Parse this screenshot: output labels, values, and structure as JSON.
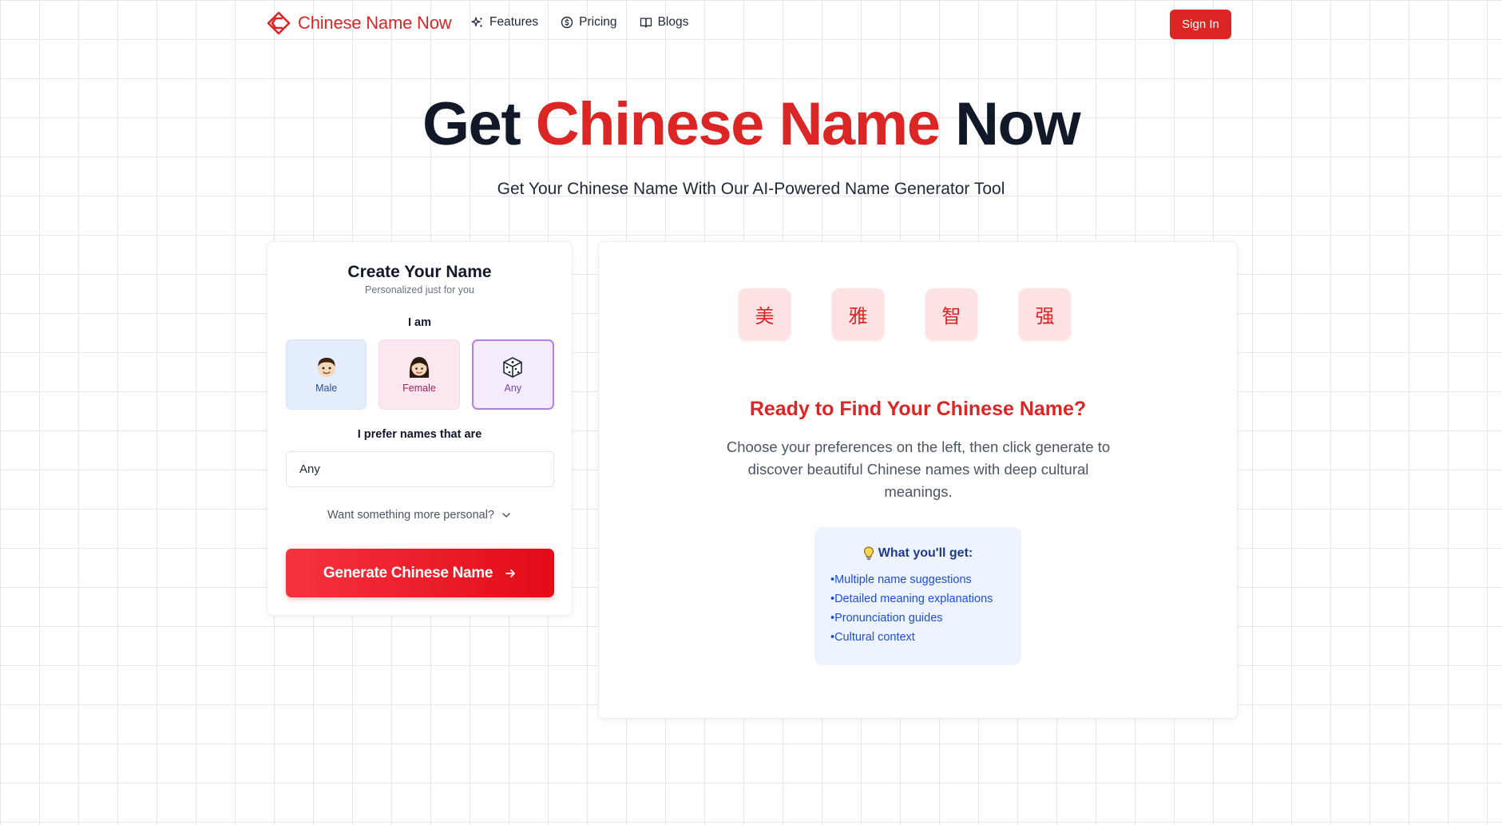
{
  "brand": {
    "name": "Chinese Name Now",
    "color": "#dc2626"
  },
  "nav": {
    "links": [
      {
        "label": "Features",
        "icon": "sparkles-icon"
      },
      {
        "label": "Pricing",
        "icon": "coin-icon"
      },
      {
        "label": "Blogs",
        "icon": "book-icon"
      }
    ],
    "signin_label": "Sign In"
  },
  "hero": {
    "title_pre": "Get ",
    "title_accent": "Chinese Name",
    "title_post": " Now",
    "subtitle": "Get Your Chinese Name With Our AI-Powered Name Generator Tool"
  },
  "form": {
    "title": "Create Your Name",
    "subtitle": "Personalized just for you",
    "gender_label": "I am",
    "genders": [
      {
        "label": "Male",
        "icon": "man-face-icon"
      },
      {
        "label": "Female",
        "icon": "woman-face-icon"
      },
      {
        "label": "Any",
        "icon": "dice-icon",
        "selected": true
      }
    ],
    "prefer_label": "I prefer names that are",
    "prefer_value": "Any",
    "more_personal": "Want something more personal?",
    "generate_label": "Generate Chinese Name"
  },
  "preview": {
    "characters": [
      "美",
      "雅",
      "智",
      "强"
    ],
    "title": "Ready to Find Your Chinese Name?",
    "description": "Choose your preferences on the left, then click generate to discover beautiful Chinese names with deep cultural meanings.",
    "benefits_title": "What you'll get:",
    "benefits_icon": "lightbulb-icon",
    "benefits": [
      "Multiple name suggestions",
      "Detailed meaning explanations",
      "Pronunciation guides",
      "Cultural context"
    ]
  }
}
